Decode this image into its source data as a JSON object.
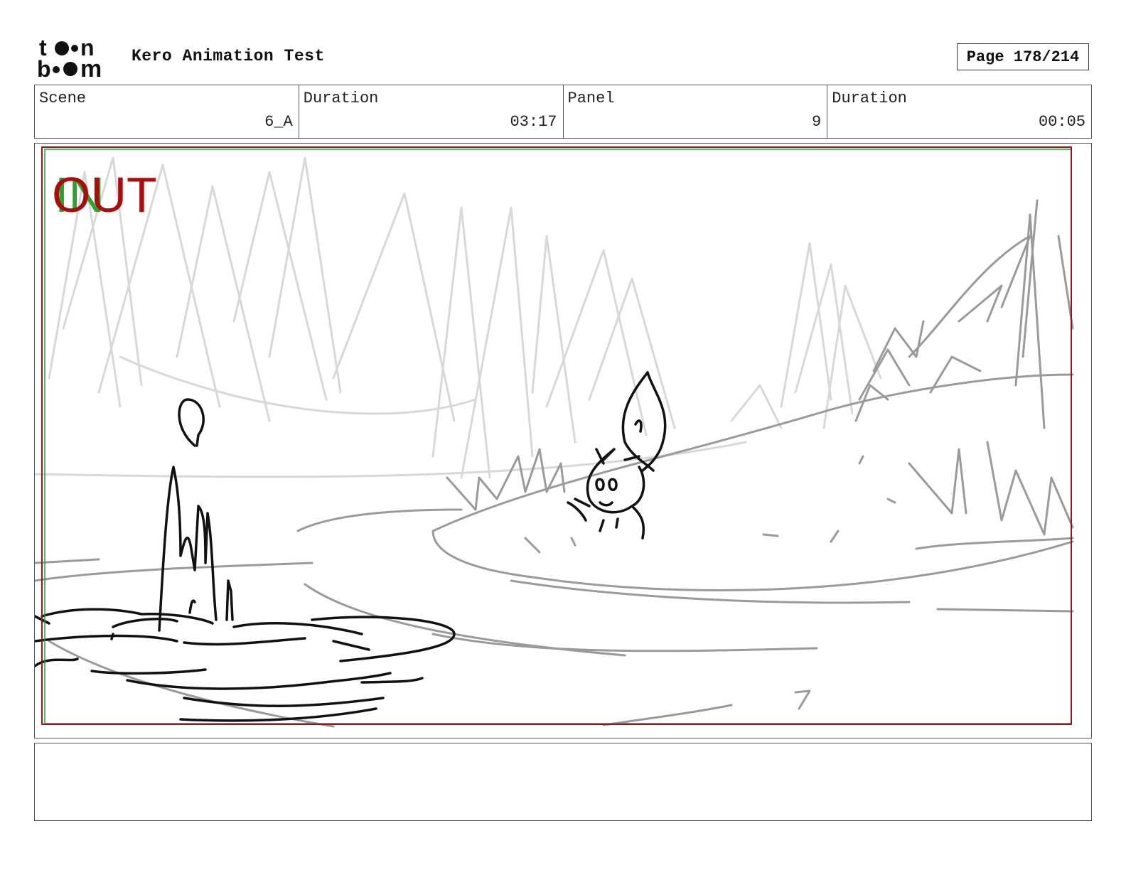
{
  "header": {
    "logo": {
      "line1": "toon",
      "line2": "boom",
      "icon": "toon-boom-logo"
    },
    "project_title": "Kero Animation Test",
    "page_label": "Page 178/214"
  },
  "info": [
    {
      "label": "Scene",
      "value": "6_A"
    },
    {
      "label": "Duration",
      "value": "03:17"
    },
    {
      "label": "Panel",
      "value": "9"
    },
    {
      "label": "Duration",
      "value": "00:05"
    }
  ],
  "panel": {
    "overlay_in": "IN",
    "overlay_out": "OUT",
    "colors": {
      "in": "#2fa12f",
      "out": "#a80e0e",
      "frame": "#8b1a1a"
    }
  },
  "notes": {
    "text": ""
  }
}
